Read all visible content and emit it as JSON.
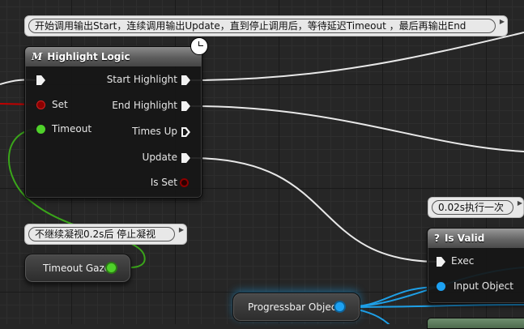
{
  "comments": {
    "main": "开始调用输出Start，连续调用输出Update，直到停止调用后，等待延迟Timeout ，最后再输出End",
    "gaze": "不继续凝视0.2s后  停止凝视",
    "valid": "0.02s执行一次"
  },
  "highlight_node": {
    "title": "Highlight Logic",
    "title_glyph": "M",
    "inputs": [
      "Set",
      "Timeout"
    ],
    "outputs": [
      "Start Highlight",
      "End Highlight",
      "Times Up",
      "Update",
      "Is Set"
    ]
  },
  "timeout_node": {
    "label": "Timeout Gaze"
  },
  "progress_node": {
    "label": "Progressbar Object"
  },
  "isvalid_node": {
    "title": "Is Valid",
    "title_glyph": "?",
    "inputs": [
      "Exec",
      "Input Object"
    ]
  },
  "colors": {
    "exec": "#f2f2f2",
    "bool_pin": "#8b0000",
    "float_pin": "#4fd12a",
    "object_pin": "#1da1f2",
    "set_wire": "#c00000",
    "float_wire": "#3aa61a",
    "object_wire": "#1e9fe6"
  }
}
